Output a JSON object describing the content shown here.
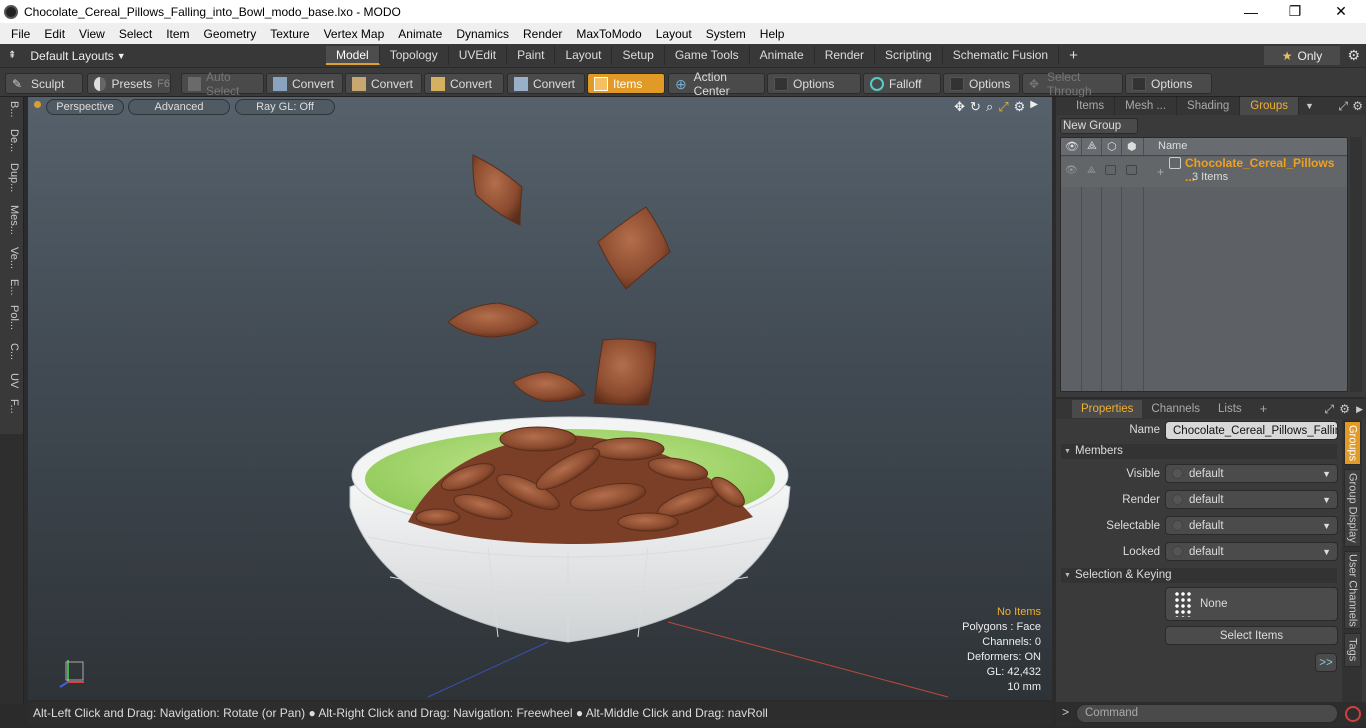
{
  "window": {
    "title": "Chocolate_Cereal_Pillows_Falling_into_Bowl_modo_base.lxo - MODO",
    "minimize": "—",
    "maximize": "❐",
    "close": "✕"
  },
  "menu": [
    "File",
    "Edit",
    "View",
    "Select",
    "Item",
    "Geometry",
    "Texture",
    "Vertex Map",
    "Animate",
    "Dynamics",
    "Render",
    "MaxToModo",
    "Layout",
    "System",
    "Help"
  ],
  "layouts": {
    "label": "Default Layouts",
    "tabs": [
      "Model",
      "Topology",
      "UVEdit",
      "Paint",
      "Layout",
      "Setup",
      "Game Tools",
      "Animate",
      "Render",
      "Scripting",
      "Schematic Fusion"
    ],
    "active_tab": "Model",
    "add": "+",
    "only_label": "Only"
  },
  "toolbar": {
    "sculpt": "Sculpt",
    "presets": "Presets",
    "presets_key": "F6",
    "auto_select": "Auto Select",
    "convert1": "Convert",
    "convert2": "Convert",
    "convert3": "Convert",
    "convert4": "Convert",
    "items": "Items",
    "action_center": "Action Center",
    "options1": "Options",
    "falloff": "Falloff",
    "options2": "Options",
    "select_through": "Select Through",
    "options3": "Options"
  },
  "left_strip": [
    "B...",
    "De...",
    "Dup...",
    "Mes...",
    "Ve...",
    "E...",
    "Pol...",
    "C...",
    "UV",
    "F..."
  ],
  "viewport": {
    "perspective": "Perspective",
    "advanced": "Advanced",
    "raygl": "Ray GL: Off",
    "info": {
      "selection": "No Items",
      "polygons": "Polygons : Face",
      "channels": "Channels: 0",
      "deformers": "Deformers: ON",
      "gl": "GL: 42,432",
      "scale": "10 mm"
    }
  },
  "status_bar": "Alt-Left Click and Drag: Navigation: Rotate (or Pan) ● Alt-Right Click and Drag: Navigation: Freewheel ● Alt-Middle Click and Drag: navRoll",
  "groups_panel": {
    "tabs": [
      "Items",
      "Mesh ...",
      "Shading",
      "Groups"
    ],
    "active_tab": "Groups",
    "new_group": "New Group",
    "name_header": "Name",
    "group": {
      "name": "Chocolate_Cereal_Pillows ...",
      "count": "3 Items"
    }
  },
  "properties_panel": {
    "tabs": [
      "Properties",
      "Channels",
      "Lists"
    ],
    "active_tab": "Properties",
    "add": "+",
    "name_label": "Name",
    "name_value": "Chocolate_Cereal_Pillows_Falling_",
    "members_section": "Members",
    "visible_label": "Visible",
    "visible_value": "default",
    "render_label": "Render",
    "render_value": "default",
    "selectable_label": "Selectable",
    "selectable_value": "default",
    "locked_label": "Locked",
    "locked_value": "default",
    "selkey_section": "Selection & Keying",
    "none_label": "None",
    "select_items": "Select Items",
    "more": ">>",
    "side_tabs": [
      "Groups",
      "Group Display",
      "User Channels",
      "Tags"
    ]
  },
  "command": {
    "prompt": ">",
    "placeholder": "Command"
  },
  "colors": {
    "accent": "#e09a25",
    "highlight_text": "#f0b030",
    "bowl_inner": "#9ed26a",
    "cereal": "#8a4a2e"
  }
}
